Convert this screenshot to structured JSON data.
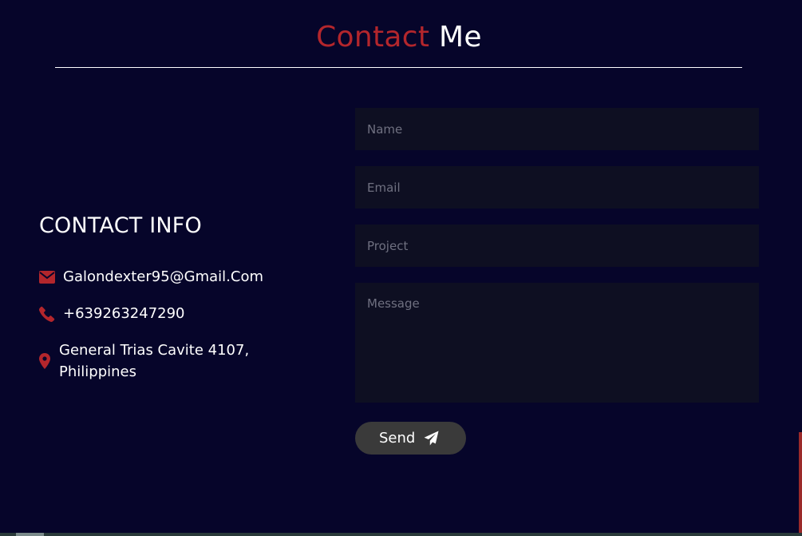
{
  "header": {
    "title_accent": "Contact",
    "title_rest": "Me"
  },
  "contact_info": {
    "heading": "CONTACT INFO",
    "email": "Galondexter95@Gmail.Com",
    "phone": "+639263247290",
    "address_line1": "General Trias Cavite 4107,",
    "address_line2": "Philippines"
  },
  "form": {
    "name_placeholder": "Name",
    "email_placeholder": "Email",
    "project_placeholder": "Project",
    "message_placeholder": "Message",
    "send_label": "Send"
  },
  "icons": {
    "email": "envelope-icon",
    "phone": "phone-icon",
    "address": "map-marker-icon",
    "send": "paper-plane-icon"
  },
  "colors": {
    "background": "#06052a",
    "accent": "#b3262c",
    "field_background": "#0e0f22",
    "button_background": "#3a3a3a",
    "text": "#ffffff"
  }
}
